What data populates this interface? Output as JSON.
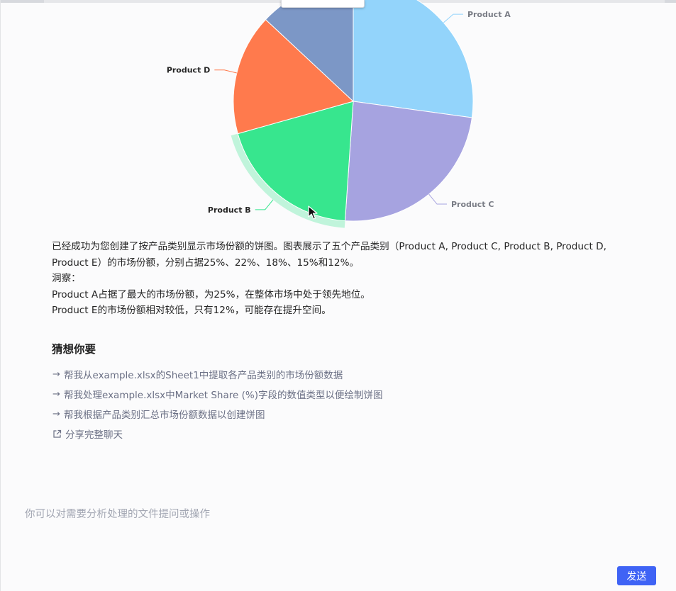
{
  "chart_data": {
    "type": "pie",
    "categories": [
      "Product A",
      "Product C",
      "Product B",
      "Product D",
      "Product E"
    ],
    "values": [
      25,
      22,
      18,
      15,
      12
    ],
    "colors": [
      "#93d4fb",
      "#a6a3e0",
      "#37e68e",
      "#ff7a4d",
      "#7c97c6"
    ],
    "highlighted": "Product B",
    "labels_visible": [
      "Product A",
      "Product C",
      "Product B",
      "Product D"
    ]
  },
  "answer": {
    "lines": [
      "已经成功为您创建了按产品类别显示市场份额的饼图。图表展示了五个产品类别（Product A, Product C, Product B, Product D,",
      "Product E）的市场份额，分别占据25%、22%、18%、15%和12%。",
      "洞察：",
      "Product A占据了最大的市场份额，为25%，在整体市场中处于领先地位。",
      "Product E的市场份额相对较低，只有12%，可能存在提升空间。"
    ]
  },
  "suggestions": {
    "title": "猜想你要",
    "items": [
      "帮我从example.xlsx的Sheet1中提取各产品类别的市场份额数据",
      "帮我处理example.xlsx中Market Share (%)字段的数值类型以便绘制饼图",
      "帮我根据产品类别汇总市场份额数据以创建饼图"
    ],
    "arrow": "→",
    "share_label": "分享完整聊天"
  },
  "input": {
    "placeholder": "你可以对需要分析处理的文件提问或操作",
    "send_label": "发送"
  },
  "icons": {
    "suggestion": "arrow-right-icon",
    "share": "external-link-icon",
    "cursor": "mouse-pointer-icon"
  }
}
